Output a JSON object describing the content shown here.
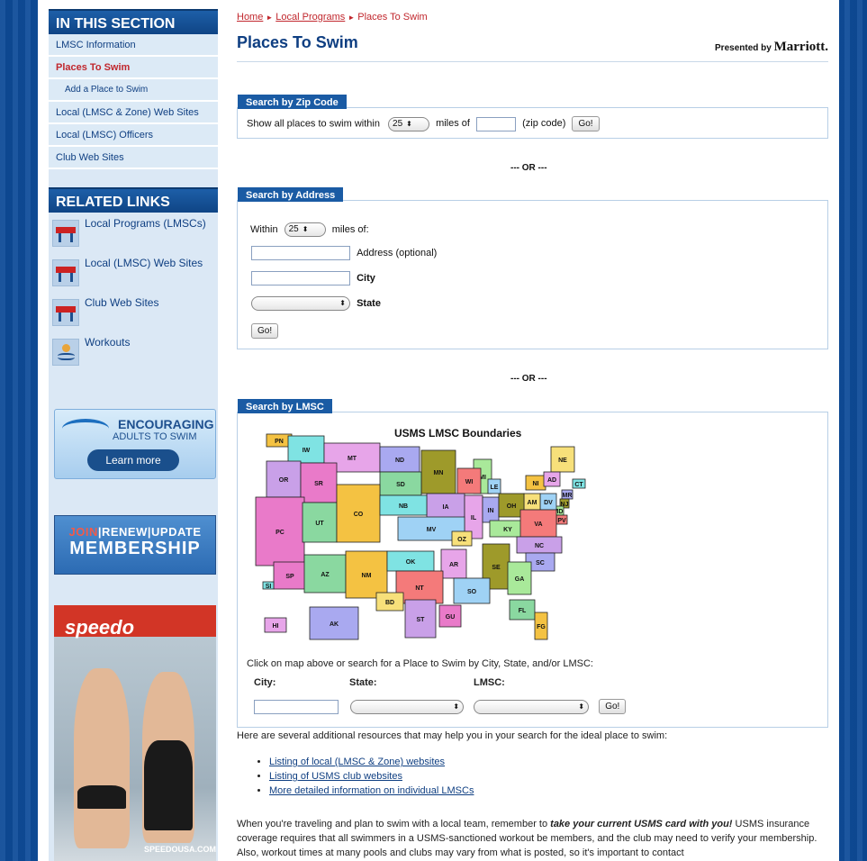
{
  "sidebar": {
    "section_title": "IN THIS SECTION",
    "items": [
      {
        "label": "LMSC Information",
        "active": false,
        "sub": false
      },
      {
        "label": "Places To Swim",
        "active": true,
        "sub": false
      },
      {
        "label": "Add a Place to Swim",
        "active": false,
        "sub": true
      },
      {
        "label": "Local (LMSC & Zone) Web Sites",
        "active": false,
        "sub": false
      },
      {
        "label": "Local (LMSC) Officers",
        "active": false,
        "sub": false
      },
      {
        "label": "Club Web Sites",
        "active": false,
        "sub": false
      }
    ],
    "related_title": "RELATED LINKS",
    "related": [
      {
        "label": "Local Programs (LMSCs)",
        "icon": "lifeguard-stand-icon"
      },
      {
        "label": "Local (LMSC) Web Sites",
        "icon": "lifeguard-stand-icon"
      },
      {
        "label": "Club Web Sites",
        "icon": "lifeguard-stand-icon"
      },
      {
        "label": "Workouts",
        "icon": "swimmer-icon"
      }
    ],
    "promo_encourage": {
      "line1": "ENCOURAGING",
      "line2": "ADULTS TO SWIM",
      "button": "Learn more"
    },
    "promo_membership": {
      "join": "JOIN",
      "renew": "RENEW",
      "update": "UPDATE",
      "sep": "|",
      "membership": "MEMBERSHIP"
    },
    "speedo_ad": {
      "brand": "speedo",
      "footer": "SPEEDOUSA.COM"
    }
  },
  "breadcrumb": {
    "home": "Home",
    "local": "Local Programs",
    "current": "Places To Swim",
    "sep": "►"
  },
  "page_title": "Places To Swim",
  "presented_by": {
    "prefix": "Presented by",
    "brand": "Marriott."
  },
  "zip_search": {
    "tab": "Search by Zip Code",
    "label_before": "Show all places to swim within",
    "miles_value": "25",
    "label_mid": "miles of",
    "zip_value": "",
    "label_after": "(zip code)",
    "go": "Go!"
  },
  "or_label": "--- OR ---",
  "address_search": {
    "tab": "Search by Address",
    "within": "Within",
    "miles_value": "25",
    "miles_of": "miles of:",
    "address_label": "Address (optional)",
    "city_label": "City",
    "state_label": "State",
    "state_value": "",
    "go": "Go!"
  },
  "lmsc_search": {
    "tab": "Search by LMSC",
    "map_title": "USMS LMSC Boundaries",
    "caption": "Click on map above or search for a Place to Swim by City, State, and/or LMSC:",
    "city_label": "City:",
    "state_label": "State:",
    "lmsc_label": "LMSC:",
    "city_value": "",
    "state_value": "",
    "lmsc_value": "",
    "go": "Go!",
    "regions": [
      "PN",
      "IW",
      "MT",
      "ND",
      "MN",
      "MI",
      "WI",
      "LE",
      "NE",
      "OR",
      "SR",
      "SD",
      "NI",
      "CT",
      "AD",
      "MR",
      "NJ",
      "MD",
      "PV",
      "DV",
      "AM",
      "IA",
      "PC",
      "UT",
      "CO",
      "NB",
      "IL",
      "IN",
      "OH",
      "KY",
      "VA",
      "MV",
      "OZ",
      "NC",
      "SP",
      "AZ",
      "NM",
      "OK",
      "AR",
      "SC",
      "SE",
      "GA",
      "NT",
      "SO",
      "BD",
      "ST",
      "GU",
      "FL",
      "FG",
      "SI",
      "HI",
      "AK"
    ]
  },
  "resources": {
    "intro": "Here are several additional resources that may help you in your search for the ideal place to swim:",
    "links": [
      "Listing of local (LMSC & Zone) websites",
      "Listing of USMS club websites",
      "More detailed information on individual LMSCs"
    ],
    "para_start": "When you're traveling and plan to swim with a local team, remember to ",
    "para_em": "take your current USMS card with you!",
    "para_end": " USMS insurance coverage requires that all swimmers in a USMS-sanctioned workout be members, and the club may need to verify your membership. Also, workout times at many pools and clubs may vary from what is posted, so it's important to contact"
  },
  "colors": {
    "nav_blue": "#0f3f82",
    "tab_blue": "#1a5ba4",
    "active_red": "#c1272d",
    "sidebar_bg": "#dbe8f5"
  }
}
